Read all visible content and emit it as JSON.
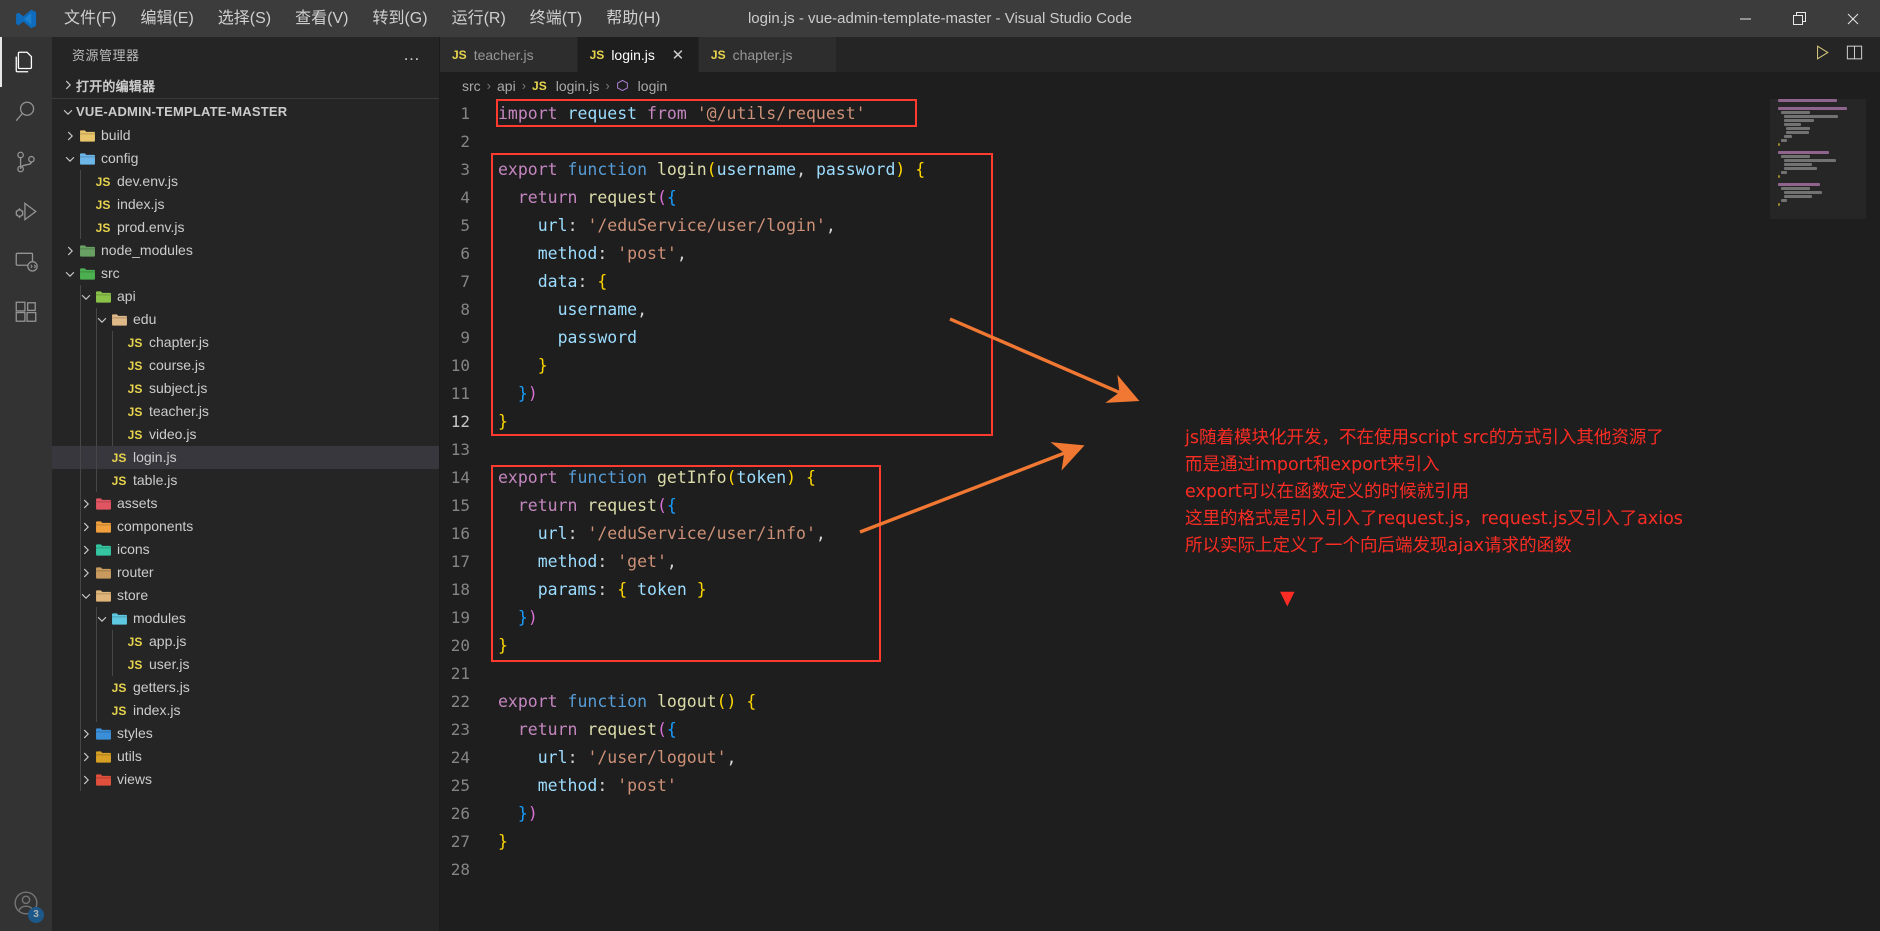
{
  "window": {
    "title": "login.js - vue-admin-template-master - Visual Studio Code",
    "minimize_label": "—",
    "maximize_label": "❐",
    "close_label": "✕"
  },
  "menubar": {
    "items": [
      {
        "label": "文件(F)",
        "name": "menu-file"
      },
      {
        "label": "编辑(E)",
        "name": "menu-edit"
      },
      {
        "label": "选择(S)",
        "name": "menu-selection"
      },
      {
        "label": "查看(V)",
        "name": "menu-view"
      },
      {
        "label": "转到(G)",
        "name": "menu-go"
      },
      {
        "label": "运行(R)",
        "name": "menu-run"
      },
      {
        "label": "终端(T)",
        "name": "menu-terminal"
      },
      {
        "label": "帮助(H)",
        "name": "menu-help"
      }
    ]
  },
  "activitybar": {
    "items": [
      {
        "icon": "files-explorer-icon",
        "active": true
      },
      {
        "icon": "search-icon",
        "active": false
      },
      {
        "icon": "source-control-icon",
        "active": false
      },
      {
        "icon": "run-and-debug-icon",
        "active": false
      },
      {
        "icon": "remote-explorer-icon",
        "active": false
      },
      {
        "icon": "extensions-icon",
        "active": false
      }
    ],
    "account_badge": "3"
  },
  "sidebar": {
    "title": "资源管理器",
    "more_actions": "…",
    "open_editors_label": "打开的编辑器",
    "project_label": "VUE-ADMIN-TEMPLATE-MASTER",
    "tree": [
      {
        "label": "build",
        "type": "folder",
        "depth": 1,
        "expanded": false,
        "icon": "folder-build-icon",
        "color": "#e8c46a"
      },
      {
        "label": "config",
        "type": "folder",
        "depth": 1,
        "expanded": true,
        "icon": "folder-config-icon",
        "color": "#6cb6e8"
      },
      {
        "label": "dev.env.js",
        "type": "file",
        "depth": 2,
        "icon": "js-file-icon"
      },
      {
        "label": "index.js",
        "type": "file",
        "depth": 2,
        "icon": "js-file-icon"
      },
      {
        "label": "prod.env.js",
        "type": "file",
        "depth": 2,
        "icon": "js-file-icon"
      },
      {
        "label": "node_modules",
        "type": "folder",
        "depth": 1,
        "expanded": false,
        "icon": "folder-node-icon",
        "color": "#68a063"
      },
      {
        "label": "src",
        "type": "folder",
        "depth": 1,
        "expanded": true,
        "icon": "folder-src-icon",
        "color": "#4caf50"
      },
      {
        "label": "api",
        "type": "folder",
        "depth": 2,
        "expanded": true,
        "icon": "folder-api-icon",
        "color": "#8bc34a"
      },
      {
        "label": "edu",
        "type": "folder",
        "depth": 3,
        "expanded": true,
        "icon": "folder-icon",
        "color": "#deb887"
      },
      {
        "label": "chapter.js",
        "type": "file",
        "depth": 4,
        "icon": "js-file-icon"
      },
      {
        "label": "course.js",
        "type": "file",
        "depth": 4,
        "icon": "js-file-icon"
      },
      {
        "label": "subject.js",
        "type": "file",
        "depth": 4,
        "icon": "js-file-icon"
      },
      {
        "label": "teacher.js",
        "type": "file",
        "depth": 4,
        "icon": "js-file-icon"
      },
      {
        "label": "video.js",
        "type": "file",
        "depth": 4,
        "icon": "js-file-icon"
      },
      {
        "label": "login.js",
        "type": "file",
        "depth": 3,
        "icon": "js-file-icon",
        "selected": true
      },
      {
        "label": "table.js",
        "type": "file",
        "depth": 3,
        "icon": "js-file-icon"
      },
      {
        "label": "assets",
        "type": "folder",
        "depth": 2,
        "expanded": false,
        "icon": "folder-assets-icon",
        "color": "#e05561"
      },
      {
        "label": "components",
        "type": "folder",
        "depth": 2,
        "expanded": false,
        "icon": "folder-components-icon",
        "color": "#f0a03c"
      },
      {
        "label": "icons",
        "type": "folder",
        "depth": 2,
        "expanded": false,
        "icon": "folder-icons-icon",
        "color": "#35c5a0"
      },
      {
        "label": "router",
        "type": "folder",
        "depth": 2,
        "expanded": false,
        "icon": "folder-router-icon",
        "color": "#c89a5e"
      },
      {
        "label": "store",
        "type": "folder",
        "depth": 2,
        "expanded": true,
        "icon": "folder-store-icon",
        "color": "#e0b57a"
      },
      {
        "label": "modules",
        "type": "folder",
        "depth": 3,
        "expanded": true,
        "icon": "folder-modules-icon",
        "color": "#5ec8e0"
      },
      {
        "label": "app.js",
        "type": "file",
        "depth": 4,
        "icon": "js-file-icon"
      },
      {
        "label": "user.js",
        "type": "file",
        "depth": 4,
        "icon": "js-file-icon"
      },
      {
        "label": "getters.js",
        "type": "file",
        "depth": 3,
        "icon": "js-file-icon"
      },
      {
        "label": "index.js",
        "type": "file",
        "depth": 3,
        "icon": "js-file-icon"
      },
      {
        "label": "styles",
        "type": "folder",
        "depth": 2,
        "expanded": false,
        "icon": "folder-styles-icon",
        "color": "#3b8fd8"
      },
      {
        "label": "utils",
        "type": "folder",
        "depth": 2,
        "expanded": false,
        "icon": "folder-utils-icon",
        "color": "#d8a024"
      },
      {
        "label": "views",
        "type": "folder",
        "depth": 2,
        "expanded": false,
        "icon": "folder-views-icon",
        "color": "#e0503c"
      }
    ]
  },
  "tabs": [
    {
      "label": "teacher.js",
      "active": false,
      "icon": "js-file-icon"
    },
    {
      "label": "login.js",
      "active": true,
      "icon": "js-file-icon",
      "close": "✕"
    },
    {
      "label": "chapter.js",
      "active": false,
      "icon": "js-file-icon"
    }
  ],
  "editor_actions": {
    "run_label": "run-icon",
    "split_label": "split-editor-icon"
  },
  "breadcrumb": {
    "items": [
      "src",
      "api",
      "login.js",
      "login"
    ],
    "separator": "›",
    "file_icon": "js-file-icon",
    "symbol_icon": "symbol-function-icon"
  },
  "code": {
    "language": "javascript",
    "lines": [
      {
        "n": 1,
        "tokens": [
          [
            "t-kw",
            "import"
          ],
          [
            "t-plain",
            " "
          ],
          [
            "t-var",
            "request"
          ],
          [
            "t-plain",
            " "
          ],
          [
            "t-kw",
            "from"
          ],
          [
            "t-plain",
            " "
          ],
          [
            "t-str",
            "'@/utils/request'"
          ]
        ]
      },
      {
        "n": 2,
        "tokens": []
      },
      {
        "n": 3,
        "tokens": [
          [
            "t-kw",
            "export"
          ],
          [
            "t-plain",
            " "
          ],
          [
            "t-blue",
            "function"
          ],
          [
            "t-plain",
            " "
          ],
          [
            "t-fn",
            "login"
          ],
          [
            "t-p1",
            "("
          ],
          [
            "t-var",
            "username"
          ],
          [
            "t-plain",
            ", "
          ],
          [
            "t-var",
            "password"
          ],
          [
            "t-p1",
            ")"
          ],
          [
            "t-plain",
            " "
          ],
          [
            "t-p1",
            "{"
          ]
        ]
      },
      {
        "n": 4,
        "tokens": [
          [
            "t-plain",
            "  "
          ],
          [
            "t-kw",
            "return"
          ],
          [
            "t-plain",
            " "
          ],
          [
            "t-fn",
            "request"
          ],
          [
            "t-p2",
            "("
          ],
          [
            "t-p3",
            "{"
          ]
        ]
      },
      {
        "n": 5,
        "tokens": [
          [
            "t-plain",
            "    "
          ],
          [
            "t-var",
            "url"
          ],
          [
            "t-plain",
            ": "
          ],
          [
            "t-str",
            "'/eduService/user/login'"
          ],
          [
            "t-plain",
            ","
          ]
        ]
      },
      {
        "n": 6,
        "tokens": [
          [
            "t-plain",
            "    "
          ],
          [
            "t-var",
            "method"
          ],
          [
            "t-plain",
            ": "
          ],
          [
            "t-str",
            "'post'"
          ],
          [
            "t-plain",
            ","
          ]
        ]
      },
      {
        "n": 7,
        "tokens": [
          [
            "t-plain",
            "    "
          ],
          [
            "t-var",
            "data"
          ],
          [
            "t-plain",
            ": "
          ],
          [
            "t-p1",
            "{"
          ]
        ]
      },
      {
        "n": 8,
        "tokens": [
          [
            "t-plain",
            "      "
          ],
          [
            "t-var",
            "username"
          ],
          [
            "t-plain",
            ","
          ]
        ]
      },
      {
        "n": 9,
        "tokens": [
          [
            "t-plain",
            "      "
          ],
          [
            "t-var",
            "password"
          ]
        ]
      },
      {
        "n": 10,
        "tokens": [
          [
            "t-plain",
            "    "
          ],
          [
            "t-p1",
            "}"
          ]
        ]
      },
      {
        "n": 11,
        "tokens": [
          [
            "t-plain",
            "  "
          ],
          [
            "t-p3",
            "}"
          ],
          [
            "t-p2",
            ")"
          ]
        ]
      },
      {
        "n": 12,
        "tokens": [
          [
            "t-p1",
            "}"
          ]
        ]
      },
      {
        "n": 13,
        "tokens": []
      },
      {
        "n": 14,
        "tokens": [
          [
            "t-kw",
            "export"
          ],
          [
            "t-plain",
            " "
          ],
          [
            "t-blue",
            "function"
          ],
          [
            "t-plain",
            " "
          ],
          [
            "t-fn",
            "getInfo"
          ],
          [
            "t-p1",
            "("
          ],
          [
            "t-var",
            "token"
          ],
          [
            "t-p1",
            ")"
          ],
          [
            "t-plain",
            " "
          ],
          [
            "t-p1",
            "{"
          ]
        ]
      },
      {
        "n": 15,
        "tokens": [
          [
            "t-plain",
            "  "
          ],
          [
            "t-kw",
            "return"
          ],
          [
            "t-plain",
            " "
          ],
          [
            "t-fn",
            "request"
          ],
          [
            "t-p2",
            "("
          ],
          [
            "t-p3",
            "{"
          ]
        ]
      },
      {
        "n": 16,
        "tokens": [
          [
            "t-plain",
            "    "
          ],
          [
            "t-var",
            "url"
          ],
          [
            "t-plain",
            ": "
          ],
          [
            "t-str",
            "'/eduService/user/info'"
          ],
          [
            "t-plain",
            ","
          ]
        ]
      },
      {
        "n": 17,
        "tokens": [
          [
            "t-plain",
            "    "
          ],
          [
            "t-var",
            "method"
          ],
          [
            "t-plain",
            ": "
          ],
          [
            "t-str",
            "'get'"
          ],
          [
            "t-plain",
            ","
          ]
        ]
      },
      {
        "n": 18,
        "tokens": [
          [
            "t-plain",
            "    "
          ],
          [
            "t-var",
            "params"
          ],
          [
            "t-plain",
            ": "
          ],
          [
            "t-p1",
            "{"
          ],
          [
            "t-plain",
            " "
          ],
          [
            "t-var",
            "token"
          ],
          [
            "t-plain",
            " "
          ],
          [
            "t-p1",
            "}"
          ]
        ]
      },
      {
        "n": 19,
        "tokens": [
          [
            "t-plain",
            "  "
          ],
          [
            "t-p3",
            "}"
          ],
          [
            "t-p2",
            ")"
          ]
        ]
      },
      {
        "n": 20,
        "tokens": [
          [
            "t-p1",
            "}"
          ]
        ]
      },
      {
        "n": 21,
        "tokens": []
      },
      {
        "n": 22,
        "tokens": [
          [
            "t-kw",
            "export"
          ],
          [
            "t-plain",
            " "
          ],
          [
            "t-blue",
            "function"
          ],
          [
            "t-plain",
            " "
          ],
          [
            "t-fn",
            "logout"
          ],
          [
            "t-p1",
            "()"
          ],
          [
            "t-plain",
            " "
          ],
          [
            "t-p1",
            "{"
          ]
        ]
      },
      {
        "n": 23,
        "tokens": [
          [
            "t-plain",
            "  "
          ],
          [
            "t-kw",
            "return"
          ],
          [
            "t-plain",
            " "
          ],
          [
            "t-fn",
            "request"
          ],
          [
            "t-p2",
            "("
          ],
          [
            "t-p3",
            "{"
          ]
        ]
      },
      {
        "n": 24,
        "tokens": [
          [
            "t-plain",
            "    "
          ],
          [
            "t-var",
            "url"
          ],
          [
            "t-plain",
            ": "
          ],
          [
            "t-str",
            "'/user/logout'"
          ],
          [
            "t-plain",
            ","
          ]
        ]
      },
      {
        "n": 25,
        "tokens": [
          [
            "t-plain",
            "    "
          ],
          [
            "t-var",
            "method"
          ],
          [
            "t-plain",
            ": "
          ],
          [
            "t-str",
            "'post'"
          ]
        ]
      },
      {
        "n": 26,
        "tokens": [
          [
            "t-plain",
            "  "
          ],
          [
            "t-p3",
            "}"
          ],
          [
            "t-p2",
            ")"
          ]
        ]
      },
      {
        "n": 27,
        "tokens": [
          [
            "t-p1",
            "}"
          ]
        ]
      },
      {
        "n": 28,
        "tokens": []
      }
    ],
    "cursor_line": 12
  },
  "annotations": {
    "color": "#fb2c24",
    "arrow_color": "#f07832",
    "notes": [
      "js随着模块化开发，不在使用script src的方式引入其他资源了",
      "而是通过import和export来引入",
      "export可以在函数定义的时候就引用",
      "这里的格式是引入引入了request.js，request.js又引入了axios",
      "所以实际上定义了一个向后端发现ajax请求的函数"
    ],
    "cursor_marker": "▼"
  }
}
